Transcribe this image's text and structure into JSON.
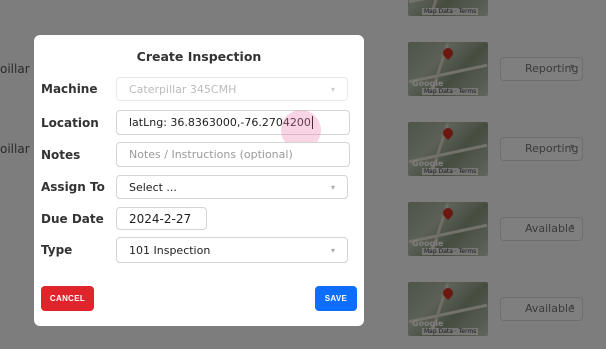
{
  "background": {
    "row_labels": [
      "oillar",
      "oillar"
    ],
    "map_google_text": "Google",
    "map_attribution": [
      "Map Data",
      "Terms"
    ],
    "status_options": [
      "Reporting",
      "Reporting",
      "Available",
      "Available"
    ]
  },
  "modal": {
    "title": "Create Inspection",
    "fields": {
      "machine": {
        "label": "Machine",
        "value": "Caterpillar 345CMH"
      },
      "location": {
        "label": "Location",
        "value": "latLng: 36.8363000,-76.2704200"
      },
      "notes": {
        "label": "Notes",
        "placeholder": "Notes / Instructions (optional)"
      },
      "assign_to": {
        "label": "Assign To",
        "value": "Select ..."
      },
      "due_date": {
        "label": "Due Date",
        "value": "2024-2-27"
      },
      "type": {
        "label": "Type",
        "value": "101 Inspection"
      }
    },
    "cancel_label": "CANCEL",
    "save_label": "SAVE"
  },
  "colors": {
    "cancel": "#e0242c",
    "save": "#0d6efd",
    "overlay": "rgba(0,0,0,0.5)"
  },
  "icons": {
    "select_caret": "chevron-down-icon",
    "map_marker": "map-pin-icon"
  }
}
